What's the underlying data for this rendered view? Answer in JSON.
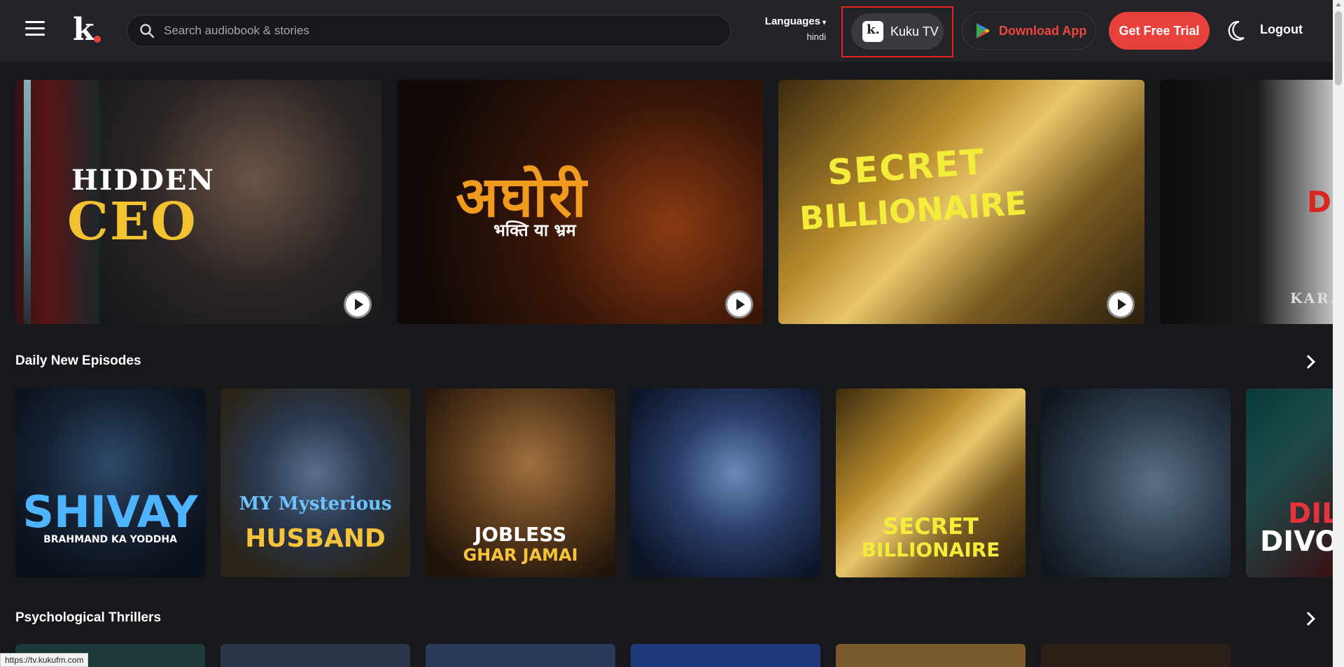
{
  "header": {
    "search_placeholder": "Search audiobook & stories",
    "languages_label": "Languages",
    "language_value": "hindi",
    "kuku_tv_label": "Kuku TV",
    "download_label": "Download App",
    "trial_label": "Get Free Trial",
    "logout_label": "Logout"
  },
  "banners": [
    {
      "title_line1": "HIDDEN",
      "title_line2": "CEO"
    },
    {
      "title_line1": "अघोरी",
      "title_line2": "भक्ति या भ्रम"
    },
    {
      "title_line1": "SECRET",
      "title_line2": "BILLIONAIRE"
    },
    {
      "title_line1": "DEV",
      "title_line2": "KARA"
    }
  ],
  "sections": [
    {
      "title": "Daily New Episodes"
    },
    {
      "title": "Psychological Thrillers"
    }
  ],
  "episodes": [
    {
      "title_line1": "SHIVAY",
      "title_line2": "BRAHMAND KA YODDHA"
    },
    {
      "title_line1": "MY Mysterious",
      "title_line2": "HUSBAND"
    },
    {
      "title_line1": "JOBLESS",
      "title_line2": "GHAR JAMAI"
    },
    {
      "title_line1": "",
      "title_line2": ""
    },
    {
      "title_line1": "SECRET",
      "title_line2": "BILLIONAIRE"
    },
    {
      "title_line1": "",
      "title_line2": ""
    },
    {
      "title_line1": "DIL",
      "title_line2": "DIVO"
    }
  ],
  "status_url": "https://tv.kukufm.com",
  "colors": {
    "accent": "#e8403a",
    "background": "#17181c",
    "header_bg": "#232429",
    "highlight_border": "#e8231d"
  }
}
